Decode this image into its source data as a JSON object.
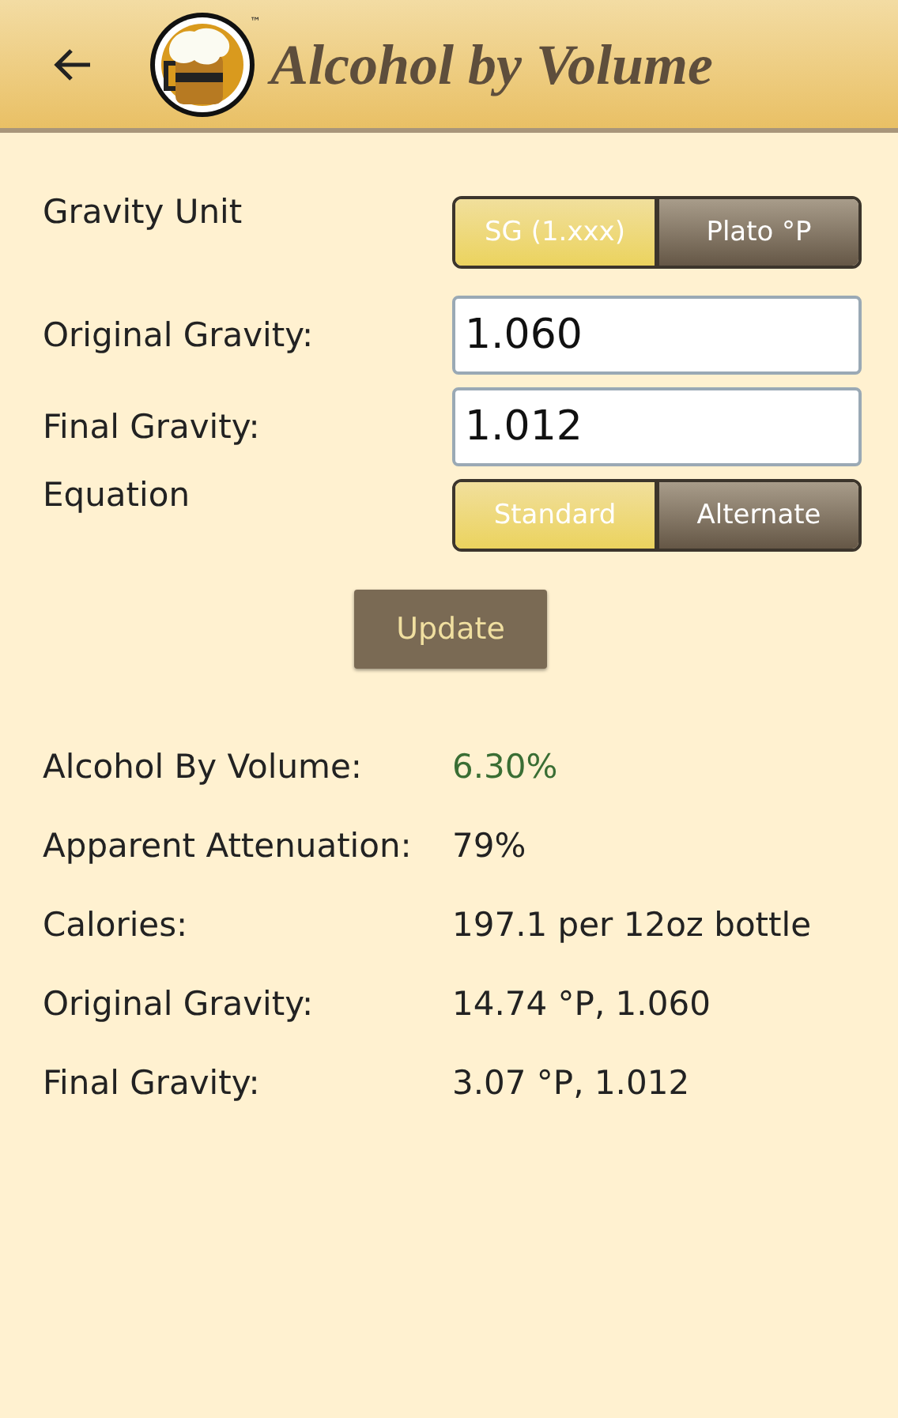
{
  "header": {
    "title": "Alcohol by Volume",
    "trademark": "™"
  },
  "gravity_unit": {
    "label": "Gravity Unit",
    "options": [
      {
        "label": "SG (1.xxx)",
        "selected": true
      },
      {
        "label": "Plato °P",
        "selected": false
      }
    ]
  },
  "fields": [
    {
      "label": "Original Gravity:",
      "value": "1.060"
    },
    {
      "label": "Final Gravity:",
      "value": "1.012"
    }
  ],
  "equation": {
    "label": "Equation",
    "options": [
      {
        "label": "Standard",
        "selected": true
      },
      {
        "label": "Alternate",
        "selected": false
      }
    ]
  },
  "update_button": "Update",
  "results": [
    {
      "label": "Alcohol By Volume:",
      "value": "6.30%",
      "kind": "highlight"
    },
    {
      "label": "Apparent Attenuation:",
      "value": "79%",
      "kind": "plain"
    },
    {
      "label": "Calories:",
      "value": "197.1 per 12oz bottle",
      "kind": "plain"
    },
    {
      "label": "Original Gravity:",
      "value": "14.74 °P, 1.060",
      "kind": "plain"
    },
    {
      "label": "Final Gravity:",
      "value": "3.07 °P, 1.012",
      "kind": "plain"
    }
  ]
}
